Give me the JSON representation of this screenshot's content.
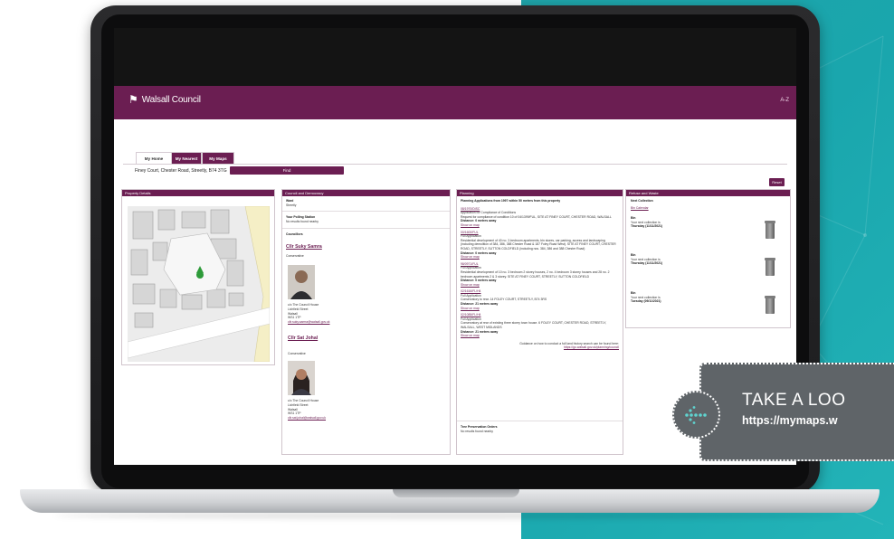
{
  "colors": {
    "brand": "#6b1e52",
    "teal": "#1fa3a8",
    "banner": "#5f6468"
  },
  "app": {
    "logo_text": "Walsall Council",
    "logo_icon": "council-crest-icon",
    "header_right": "A-Z",
    "tabs": [
      {
        "label": "My Home",
        "active": true
      },
      {
        "label": "My Nearest",
        "active": false
      },
      {
        "label": "My Maps",
        "active": false
      }
    ],
    "address": "Finey Court, Chester Road, Streetly, B74 3TG",
    "find_label": "Find",
    "reset_label": "Reset"
  },
  "panels": {
    "property": {
      "title": "Property Details"
    },
    "council": {
      "title": "Council and Democracy",
      "ward_label": "Ward",
      "ward_value": "Streetly",
      "polling_title": "Your Polling Station",
      "polling_value": "No results found nearby",
      "councillors_title": "Councillors",
      "councillors": [
        {
          "name": "Cllr Suky Samra",
          "party": "Conservative",
          "address": [
            "c/o The Council House",
            "Lichfield Street",
            "Walsall",
            "WS1 1TP"
          ],
          "email": "cllr.suky.samra@walsall.gov.uk"
        },
        {
          "name": "Cllr Sat Johal",
          "party": "Conservative",
          "address": [
            "c/o The Council House",
            "Lichfield Street",
            "Walsall",
            "WS1 1TP"
          ],
          "email": "cllr.sat.johal@walsall.gov.uk"
        }
      ]
    },
    "planning": {
      "title": "Planning",
      "heading": "Planning Applications from 1997 within 50 metres from this property",
      "applications": [
        {
          "ref": "08/1970/DISC",
          "type": "Application for Compliance of Conditions",
          "desc": "Request for compliance of condition 10 of 04/1399/FUL, SITE AT FINEY COURT, CHESTER ROAD, WALSALL",
          "distance": "Distance: 0 metres away",
          "map_link": "Show on map"
        },
        {
          "ref": "00/1600/FUL",
          "type": "Full Application",
          "desc": "Residential development of 40 no. 2-bedroom apartments, bin stores, car parking, access and landscaping (including demolition of 384, 386, 388 Chester Road & 187 Foley Road West). SITE AT FINEY COURT, CHESTER ROAD, STREETLY, SUTTON COLDFIELD (including nos. 384, 386 and 388 Chester Road)",
          "distance": "Distance: 0 metres away",
          "map_link": "Show on map"
        },
        {
          "ref": "98/0971/FUL",
          "type": "Full Application",
          "desc": "Residential development of 10 no. 3 bedroom 2 storey houses, 2 no. 4 bedroom 3 storey houses and 28 no. 2 bedroom apartments 2 & 3 storey. SITE AT FINEY COURT, STREETLY, SUTTON COLDFIELD",
          "distance": "Distance: 0 metres away",
          "map_link": "Show on map"
        },
        {
          "ref": "02/1616/FL/H4",
          "type": "Full Application",
          "desc": "Conservatory to rear. 14 FOLEY COURT, STREETLY, B74 3RS",
          "distance": "Distance: 21 metres away",
          "map_link": "Show on map"
        },
        {
          "ref": "02/1085/FL/H4",
          "type": "Full Application",
          "desc": "Conservatory at rear of existing three storey town house. 6 FOLEY COURT, CHESTER ROAD, STREETLY, WALSALL, WEST MIDLANDS",
          "distance": "Distance: 21 metres away",
          "map_link": "Show on map"
        }
      ],
      "guidance": "Guidance on how to conduct a full land history search can be found here:",
      "guidance_link": "https://go.walsall.gov.uk/planning/council",
      "tpo_title": "Tree Preservation Orders",
      "tpo_value": "No results found nearby"
    },
    "refuse": {
      "title": "Refuse and Waste",
      "next_title": "Next Collection",
      "calendar_link": "Bin Calendar",
      "bins": [
        {
          "label": "Bin",
          "line": "Your next collection is",
          "date": "Thursday (11/11/2021)"
        },
        {
          "label": "Bin",
          "line": "Your next collection is",
          "date": "Thursday (11/11/2021)"
        },
        {
          "label": "Bin",
          "line": "Your next collection is",
          "date": "Tuesday (09/11/2021)"
        }
      ]
    }
  },
  "banner": {
    "title": "TAKE A LOO",
    "url": "https://mymaps.w",
    "icon": "arrow-left-dotted-icon"
  }
}
